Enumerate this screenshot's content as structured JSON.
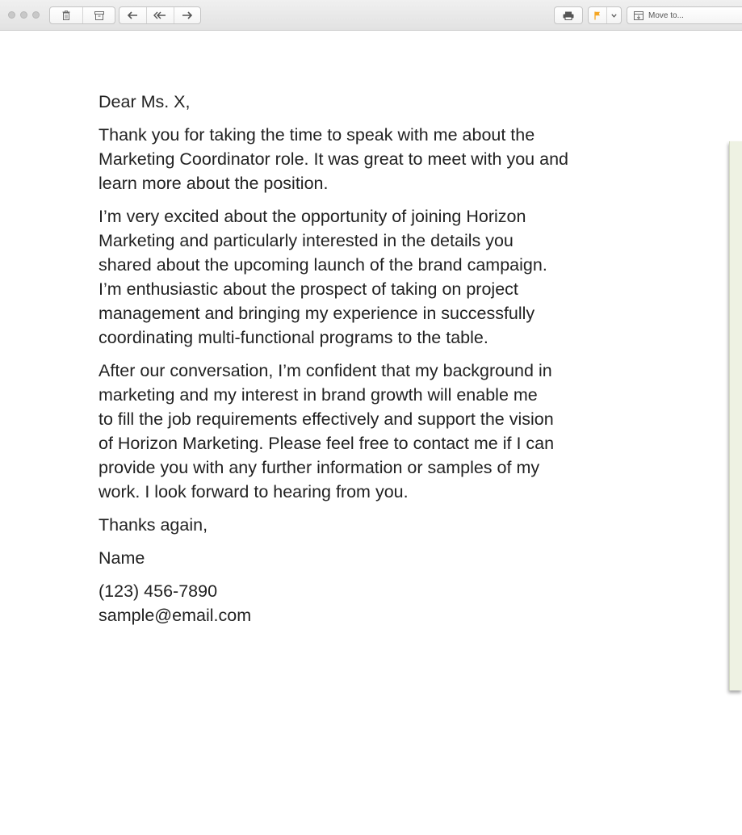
{
  "toolbar": {
    "traffic_lights": [
      "close",
      "minimize",
      "zoom"
    ],
    "buttons": {
      "delete_icon": "trash-icon",
      "archive_icon": "archive-icon",
      "reply_icon": "reply-icon",
      "reply_all_icon": "reply-all-icon",
      "forward_icon": "forward-icon",
      "print_icon": "printer-icon",
      "flag_icon": "flag-icon",
      "flag_color": "#f5a623",
      "move_icon": "move-icon",
      "move_label": "Move to..."
    }
  },
  "letter": {
    "greeting": "Dear Ms. X,",
    "paragraph1": [
      "Thank you for taking the time to speak with me about the",
      "Marketing Coordinator role. It was great to meet with you and",
      "learn more about the position."
    ],
    "paragraph2": [
      "I’m very excited about the opportunity of joining Horizon",
      "Marketing and particularly interested in the details you",
      "shared about the upcoming launch of the brand campaign.",
      "I’m enthusiastic about the prospect of taking on project",
      "management and bringing my experience in successfully",
      "coordinating multi-functional programs to the table."
    ],
    "paragraph3": [
      "After our conversation, I’m confident that my background in",
      "marketing and my interest in brand growth will enable me",
      "to fill the job requirements effectively and support the vision",
      "of Horizon Marketing. Please feel free to contact me if I can",
      "provide you with any further information or samples of my",
      "work. I look forward to hearing from you."
    ],
    "closing": "Thanks again,",
    "name": "Name",
    "phone": "(123) 456-7890",
    "email": "sample@email.com"
  },
  "colors": {
    "side_panel": "#eef2e3",
    "text": "#222222"
  }
}
